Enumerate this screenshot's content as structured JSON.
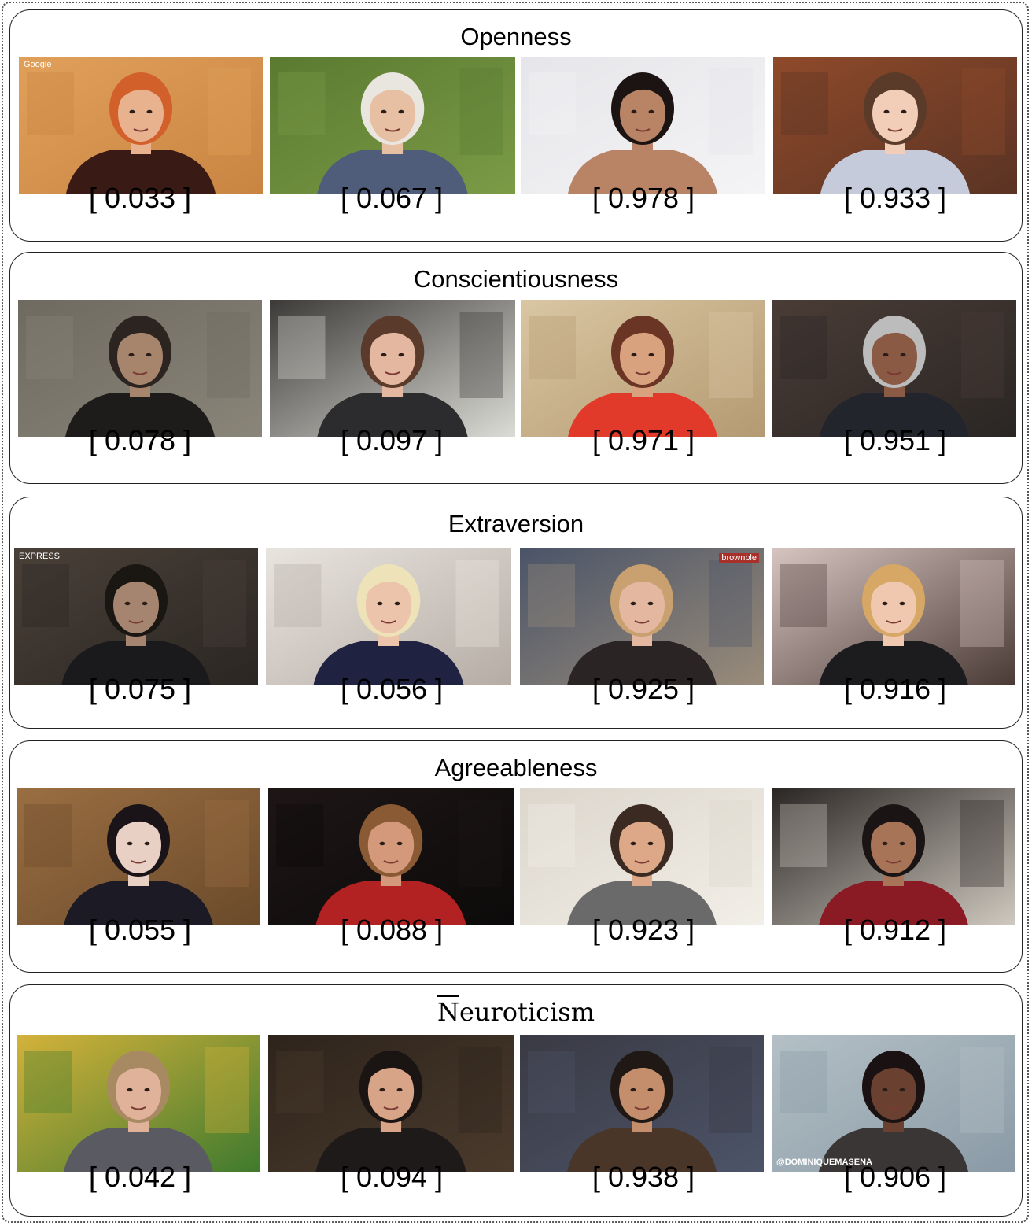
{
  "panels": [
    {
      "title": "Openness",
      "items": [
        {
          "score": "[ 0.033 ]",
          "bg": "#c98442",
          "bg2": "#e0a05a",
          "skin": "#e9b28f",
          "hair": "#d2602a",
          "shirt": "#3a1a14",
          "watermark": "Google"
        },
        {
          "score": "[ 0.067 ]",
          "bg": "#7c9b47",
          "bg2": "#5a7a30",
          "skin": "#e7bfa3",
          "hair": "#e9e6df",
          "shirt": "#4f5c7a"
        },
        {
          "score": "[ 0.978 ]",
          "bg": "#f4f4f6",
          "bg2": "#e6e6ea",
          "skin": "#b98466",
          "hair": "#1c1412",
          "shirt": "#b98466"
        },
        {
          "score": "[ 0.933 ]",
          "bg": "#5a3324",
          "bg2": "#8f4a2a",
          "skin": "#f2cdb8",
          "hair": "#5a3a28",
          "shirt": "#c5cbdb"
        }
      ]
    },
    {
      "title": "Conscientiousness",
      "items": [
        {
          "score": "[ 0.078 ]",
          "bg": "#8a8579",
          "bg2": "#6e6a60",
          "skin": "#a7856d",
          "hair": "#2b2420",
          "shirt": "#1e1c1a"
        },
        {
          "score": "[ 0.097 ]",
          "bg": "#dcdcd6",
          "bg2": "#3c3a38",
          "skin": "#e4b7a0",
          "hair": "#5a3a2a",
          "shirt": "#2c2c2e"
        },
        {
          "score": "[ 0.971 ]",
          "bg": "#b49a72",
          "bg2": "#d9c6a2",
          "skin": "#d9a27f",
          "hair": "#6a3524",
          "shirt": "#e23a2a"
        },
        {
          "score": "[ 0.951 ]",
          "bg": "#2a2624",
          "bg2": "#4a3c36",
          "skin": "#8a5a44",
          "hair": "#bcbcbc",
          "shirt": "#23252c"
        }
      ]
    },
    {
      "title": "Extraversion",
      "items": [
        {
          "score": "[ 0.075 ]",
          "bg": "#2a2622",
          "bg2": "#4a4038",
          "skin": "#a58570",
          "hair": "#1a1612",
          "shirt": "#1a1a1c",
          "watermark": "EXPRESS"
        },
        {
          "score": "[ 0.056 ]",
          "bg": "#b5aca5",
          "bg2": "#e8e4de",
          "skin": "#ecc4ac",
          "hair": "#eee2b8",
          "shirt": "#1f2240"
        },
        {
          "score": "[ 0.925 ]",
          "bg": "#9a8c7a",
          "bg2": "#4a5468",
          "skin": "#e4b8a0",
          "hair": "#c9a070",
          "shirt": "#2a2424",
          "watermark": "brownble"
        },
        {
          "score": "[ 0.916 ]",
          "bg": "#4a3a36",
          "bg2": "#d6c4c0",
          "skin": "#f0c8b0",
          "hair": "#d7a766",
          "shirt": "#1c1c1e"
        }
      ]
    },
    {
      "title": "Agreeableness",
      "items": [
        {
          "score": "[ 0.055 ]",
          "bg": "#6a4a2a",
          "bg2": "#9a6e42",
          "skin": "#e8d0c4",
          "hair": "#1a1418",
          "shirt": "#1c1a24"
        },
        {
          "score": "[ 0.088 ]",
          "bg": "#0c0a0a",
          "bg2": "#1e1616",
          "skin": "#d4987a",
          "hair": "#8a5a34",
          "shirt": "#b22222"
        },
        {
          "score": "[ 0.923 ]",
          "bg": "#f2efe8",
          "bg2": "#dcd6cc",
          "skin": "#dca888",
          "hair": "#3a2a22",
          "shirt": "#6a6a6a"
        },
        {
          "score": "[ 0.912 ]",
          "bg": "#cfc9bf",
          "bg2": "#2a2624",
          "skin": "#a87458",
          "hair": "#1a1414",
          "shirt": "#8a1a24"
        }
      ]
    },
    {
      "title": "Neuroticism",
      "items": [
        {
          "score": "[ 0.042 ]",
          "bg": "#3f7a2e",
          "bg2": "#d4b23a",
          "skin": "#e0b29a",
          "hair": "#a88a62",
          "shirt": "#5a5a62"
        },
        {
          "score": "[ 0.094 ]",
          "bg": "#4a3a2c",
          "bg2": "#2e241c",
          "skin": "#d8a488",
          "hair": "#1a1412",
          "shirt": "#1e1a1a"
        },
        {
          "score": "[ 0.938 ]",
          "bg": "#4c5468",
          "bg2": "#3a3a44",
          "skin": "#c48e6c",
          "hair": "#201814",
          "shirt": "#4a3628"
        },
        {
          "score": "[ 0.906 ]",
          "bg": "#8a9aa6",
          "bg2": "#b4c0c6",
          "skin": "#6a4030",
          "hair": "#1a1212",
          "shirt": "#3a3636",
          "watermark": "@DOMINIQUEMASENA"
        }
      ]
    }
  ]
}
